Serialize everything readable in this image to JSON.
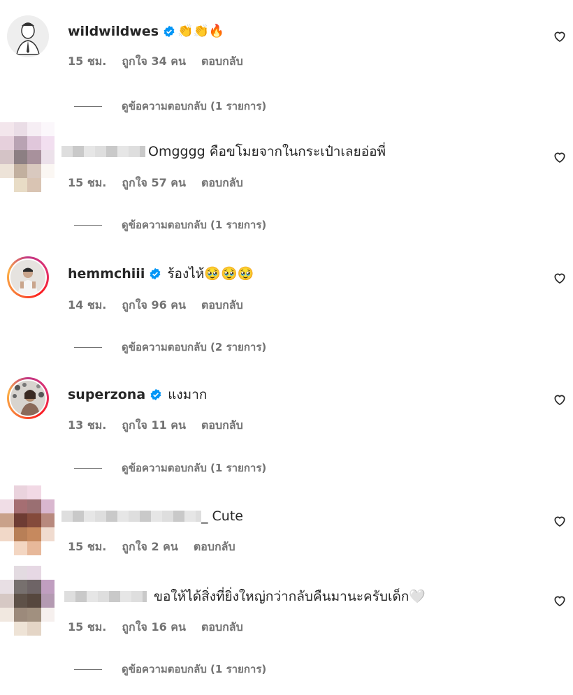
{
  "comments": [
    {
      "username": "wildwildwes",
      "verified": true,
      "text": "👏👏🔥",
      "time": "15 ชม.",
      "likes": "ถูกใจ 34 คน",
      "reply": "ตอบกลับ",
      "view_replies": "ดูข้อความตอบกลับ (1 รายการ)"
    },
    {
      "username": "",
      "verified": false,
      "text": "Omgggg คือขโมยจากในกระเป๋าเลยอ่อพี่",
      "time": "15 ชม.",
      "likes": "ถูกใจ 57 คน",
      "reply": "ตอบกลับ",
      "view_replies": "ดูข้อความตอบกลับ (1 รายการ)"
    },
    {
      "username": "hemmchiii",
      "verified": true,
      "text": "ร้องไห้🥹🥹🥹",
      "time": "14 ชม.",
      "likes": "ถูกใจ 96 คน",
      "reply": "ตอบกลับ",
      "view_replies": "ดูข้อความตอบกลับ (2 รายการ)"
    },
    {
      "username": "superzona",
      "verified": true,
      "text": "แงมาก",
      "time": "13 ชม.",
      "likes": "ถูกใจ 11 คน",
      "reply": "ตอบกลับ",
      "view_replies": "ดูข้อความตอบกลับ (1 รายการ)"
    },
    {
      "username": "",
      "verified": false,
      "text": "_ Cute",
      "time": "15 ชม.",
      "likes": "ถูกใจ 2 คน",
      "reply": "ตอบกลับ"
    },
    {
      "username": "",
      "verified": false,
      "text": "ขอให้ได้สิ่งที่ยิ่งใหญ่กว่ากลับคืนมานะครับเด็ก🤍",
      "time": "15 ชม.",
      "likes": "ถูกใจ 16 คน",
      "reply": "ตอบกลับ",
      "view_replies": "ดูข้อความตอบกลับ (1 รายการ)"
    }
  ],
  "icons": {
    "like": "heart-outline-icon",
    "verified": "verified-badge-icon"
  },
  "colors": {
    "text": "#262626",
    "secondary": "#737373",
    "verified": "#0095f6"
  }
}
